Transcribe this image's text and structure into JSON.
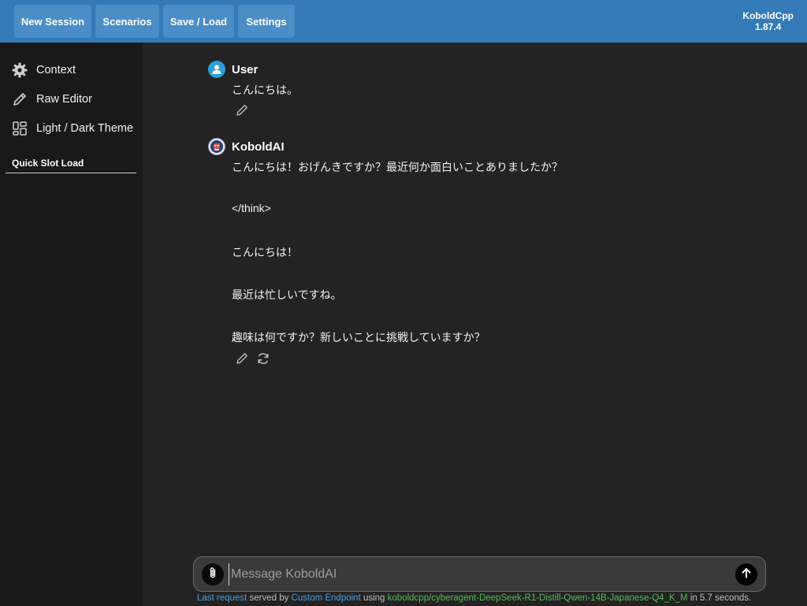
{
  "toolbar": {
    "new_session": "New Session",
    "scenarios": "Scenarios",
    "save_load": "Save / Load",
    "settings": "Settings"
  },
  "brand": {
    "name": "KoboldCpp",
    "version": "1.87.4"
  },
  "sidebar": {
    "items": [
      {
        "label": "Context",
        "icon": "gear-icon"
      },
      {
        "label": "Raw Editor",
        "icon": "pencil-icon"
      },
      {
        "label": "Light / Dark Theme",
        "icon": "layout-icon"
      }
    ],
    "quick_slot_label": "Quick Slot Load"
  },
  "chat": {
    "messages": [
      {
        "sender": "User",
        "lines": [
          "こんにちは。"
        ],
        "actions": [
          "edit-icon"
        ]
      },
      {
        "sender": "KoboldAI",
        "lines": [
          "こんにちは！おげんきですか？最近何か面白いことありましたか？",
          "</think>",
          "こんにちは！",
          "最近は忙しいですね。",
          "趣味は何ですか？新しいことに挑戦していますか？"
        ],
        "actions": [
          "edit-icon",
          "regenerate-icon"
        ]
      }
    ]
  },
  "input": {
    "placeholder": "Message KoboldAI",
    "value": ""
  },
  "status": {
    "last_request": "Last request",
    "served_by": " served by ",
    "endpoint": "Custom Endpoint",
    "using": " using ",
    "model": "koboldcpp/cyberagent-DeepSeek-R1-Distill-Qwen-14B-Japanese-Q4_K_M",
    "timing": " in 5.7 seconds."
  },
  "colors": {
    "topbar": "#337ab7",
    "button": "#4a8dc7",
    "sidebar": "#191919",
    "chat_bg": "#232323",
    "link": "#4a9fe0",
    "model": "#5cb85c",
    "user_avatar": "#2a9fd6"
  }
}
